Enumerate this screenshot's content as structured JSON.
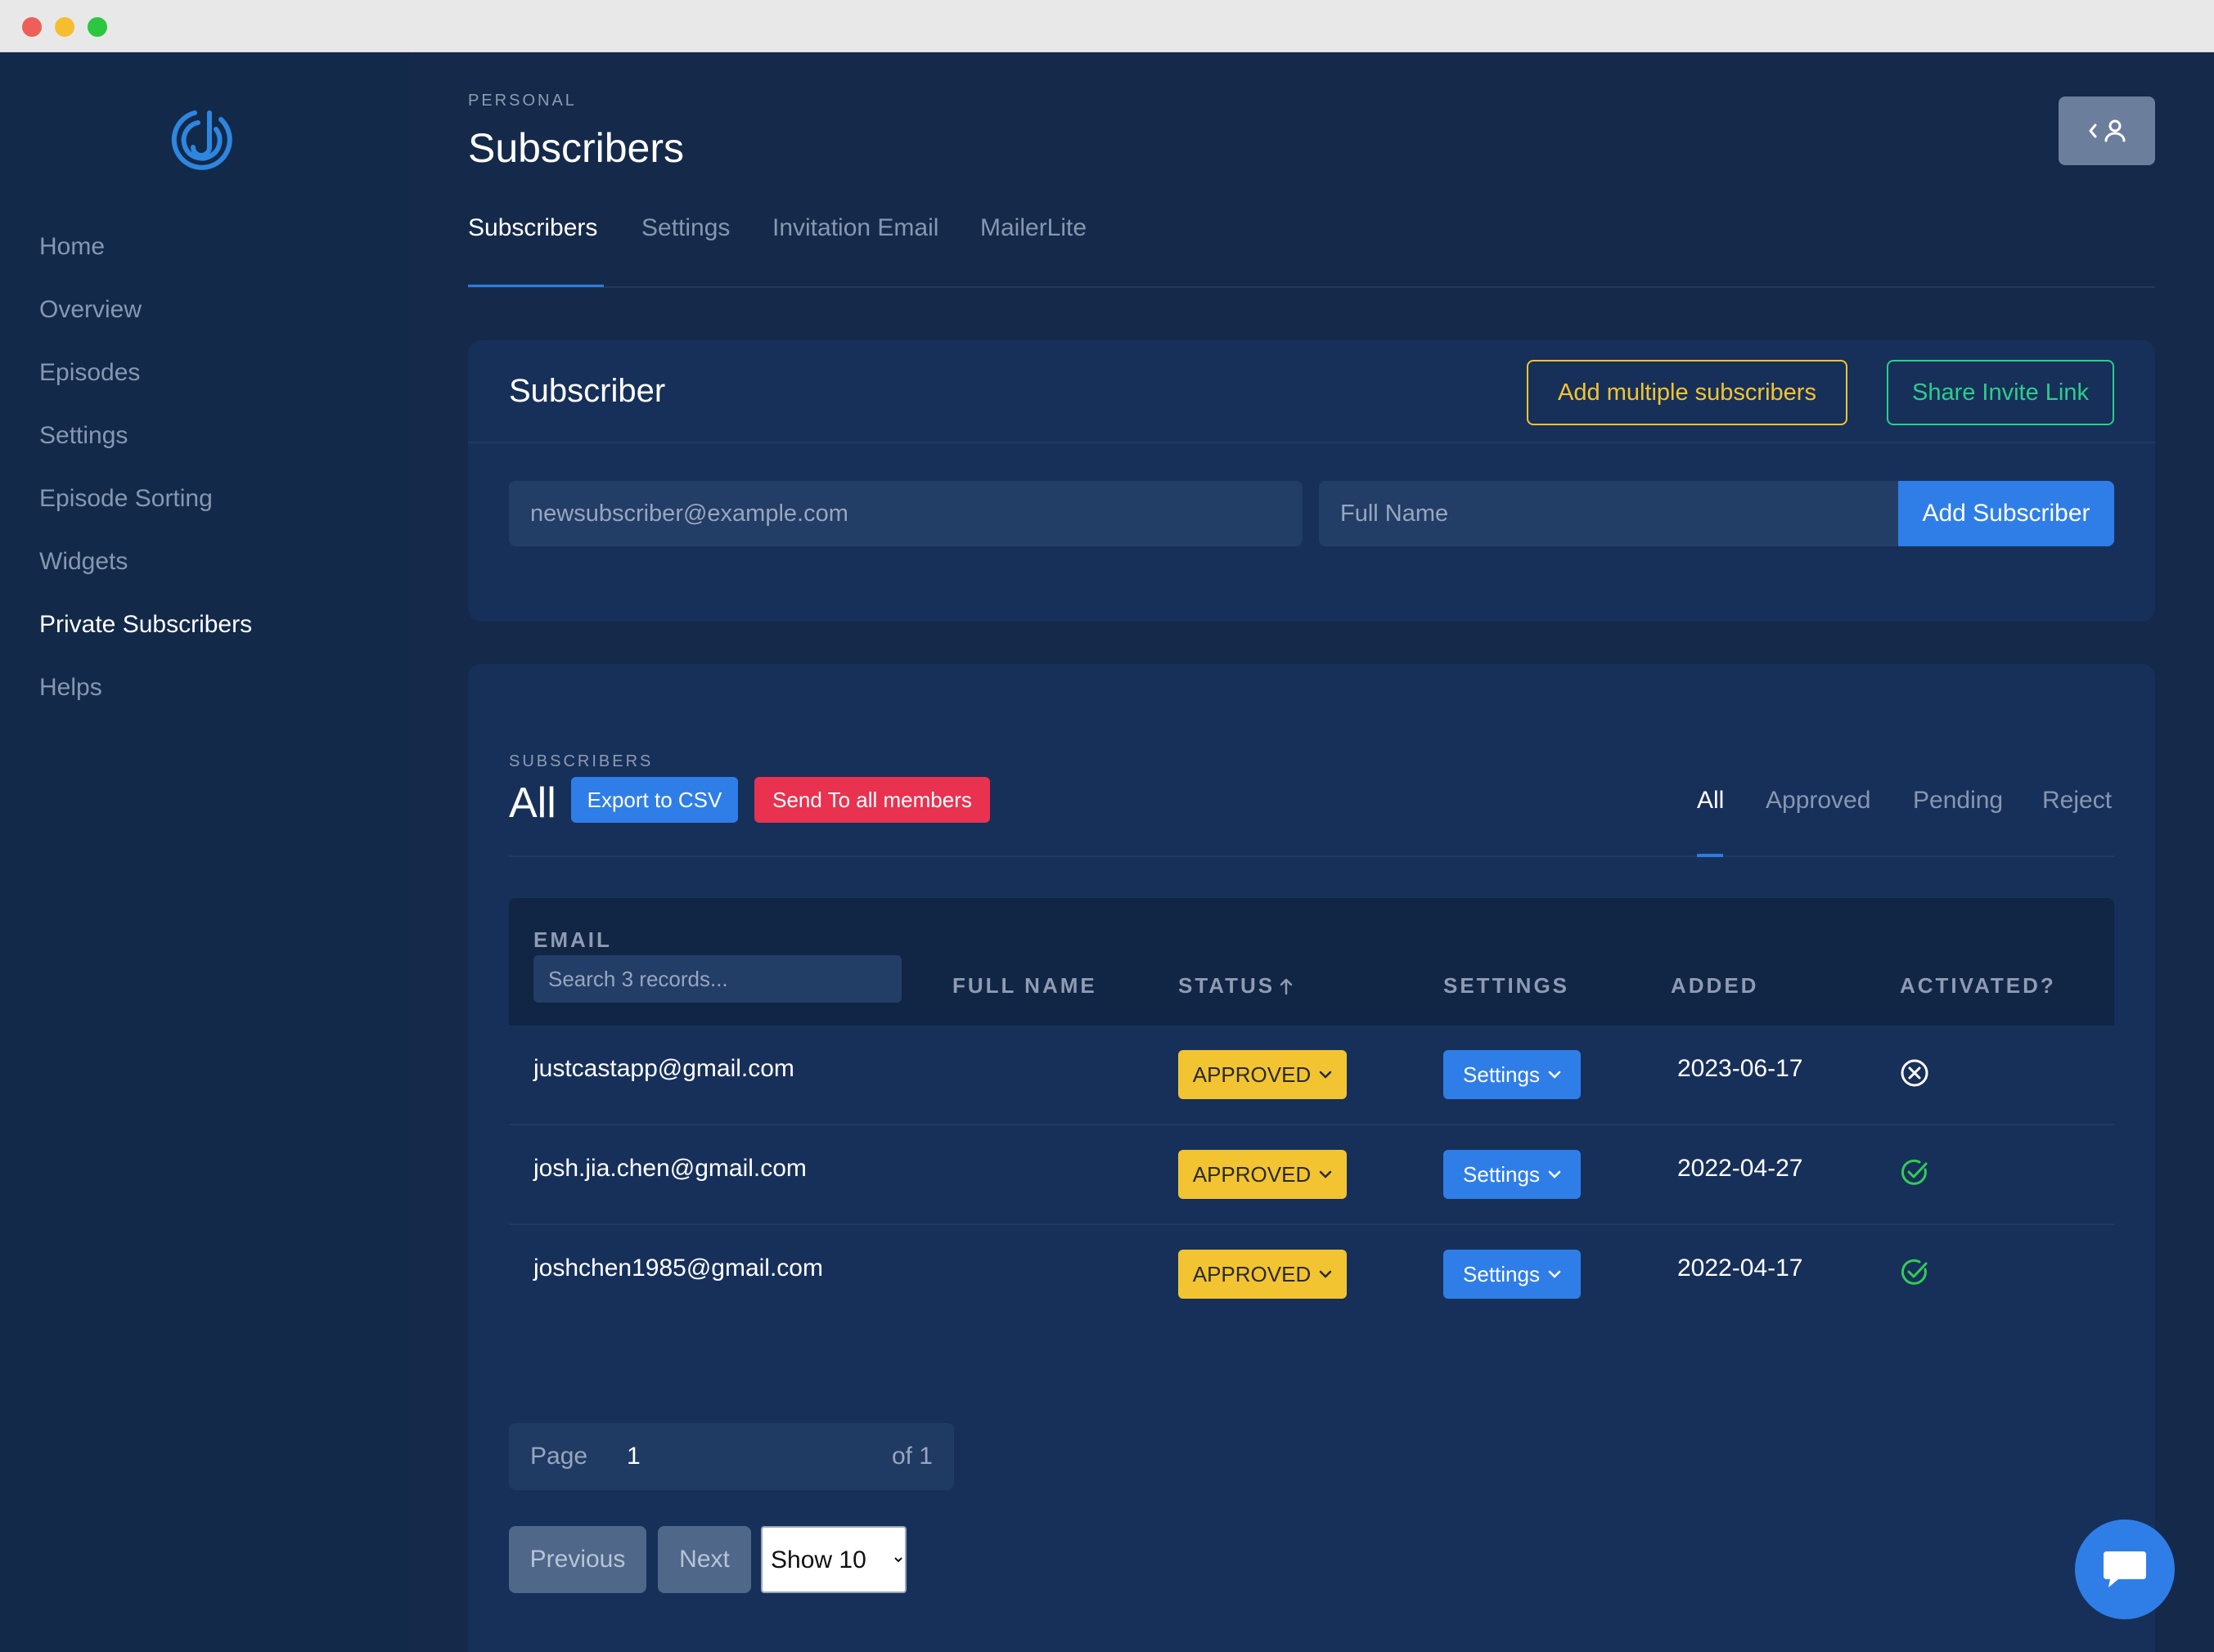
{
  "sidebar": {
    "items": [
      {
        "label": "Home"
      },
      {
        "label": "Overview"
      },
      {
        "label": "Episodes"
      },
      {
        "label": "Settings"
      },
      {
        "label": "Episode Sorting"
      },
      {
        "label": "Widgets"
      },
      {
        "label": "Private Subscribers",
        "active": true
      },
      {
        "label": "Helps"
      }
    ]
  },
  "header": {
    "eyebrow": "PERSONAL",
    "title": "Subscribers"
  },
  "tabs": [
    {
      "label": "Subscribers",
      "active": true
    },
    {
      "label": "Settings"
    },
    {
      "label": "Invitation Email"
    },
    {
      "label": "MailerLite"
    }
  ],
  "subscriber_card": {
    "title": "Subscriber",
    "add_multiple_label": "Add multiple subscribers",
    "share_invite_label": "Share Invite Link",
    "email_placeholder": "newsubscriber@example.com",
    "name_placeholder": "Full Name",
    "add_button_label": "Add Subscriber"
  },
  "list": {
    "eyebrow": "SUBSCRIBERS",
    "title": "All",
    "export_label": "Export to CSV",
    "send_label": "Send To all members",
    "filters": [
      {
        "label": "All",
        "active": true
      },
      {
        "label": "Approved"
      },
      {
        "label": "Pending"
      },
      {
        "label": "Reject"
      }
    ],
    "columns": {
      "email": "EMAIL",
      "full_name": "FULL NAME",
      "status": "STATUS",
      "settings": "SETTINGS",
      "added": "ADDED",
      "activated": "ACTIVATED?"
    },
    "search_placeholder": "Search 3 records...",
    "rows": [
      {
        "email": "justcastapp@gmail.com",
        "full_name": "",
        "status": "APPROVED",
        "settings": "Settings",
        "added": "2023-06-17",
        "activated": false
      },
      {
        "email": "josh.jia.chen@gmail.com",
        "full_name": "",
        "status": "APPROVED",
        "settings": "Settings",
        "added": "2022-04-27",
        "activated": true
      },
      {
        "email": "joshchen1985@gmail.com",
        "full_name": "",
        "status": "APPROVED",
        "settings": "Settings",
        "added": "2022-04-17",
        "activated": true
      }
    ]
  },
  "pagination": {
    "page_label": "Page",
    "page_value": "1",
    "of_label": "of 1",
    "previous_label": "Previous",
    "next_label": "Next",
    "show_options": [
      "Show 10"
    ],
    "show_selected": "Show 10"
  },
  "colors": {
    "accent": "#2f7ee8",
    "approved": "#f3c431",
    "danger": "#e8324f",
    "success": "#2ecc8c",
    "background": "#15294a"
  }
}
